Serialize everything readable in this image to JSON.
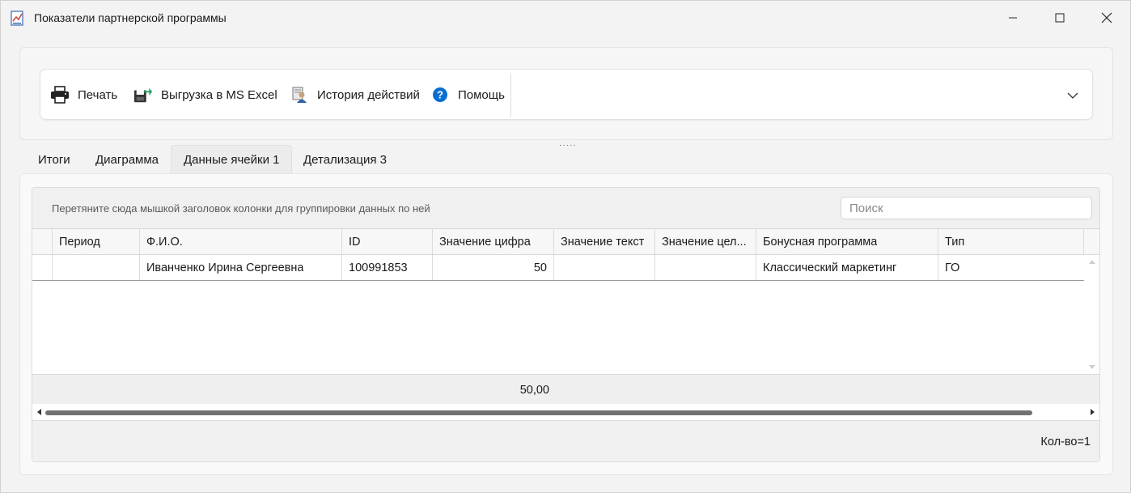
{
  "window": {
    "title": "Показатели партнерской программы"
  },
  "toolbar": {
    "print_label": "Печать",
    "excel_label": "Выгрузка в MS Excel",
    "history_label": "История действий",
    "help_label": "Помощь"
  },
  "tabs": [
    {
      "label": "Итоги"
    },
    {
      "label": "Диаграмма"
    },
    {
      "label": "Данные ячейки 1"
    },
    {
      "label": "Детализация 3"
    }
  ],
  "active_tab": "Данные ячейки 1",
  "grid": {
    "group_hint": "Перетяните сюда мышкой заголовок колонки для группировки данных по ней",
    "search_placeholder": "Поиск",
    "columns": [
      "Период",
      "Ф.И.О.",
      "ID",
      "Значение цифра",
      "Значение текст",
      "Значение цел...",
      "Бонусная программа",
      "Тип"
    ],
    "rows": [
      [
        "",
        "Иванченко Ирина Сергеевна",
        "100991853",
        "50",
        "",
        "",
        "Классический маркетинг",
        "ГО"
      ]
    ],
    "total_value": "50,00",
    "count_label": "Кол-во=1"
  },
  "colors": {
    "window_bg": "#f3f3f3",
    "help_icon": "#0a6ed1",
    "excel_icon_accent": "#21a366",
    "scroll_thumb": "#707070"
  }
}
